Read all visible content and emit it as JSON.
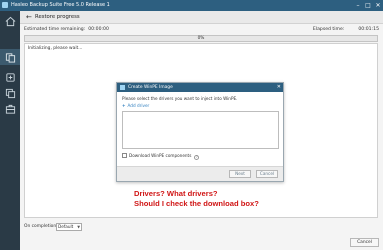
{
  "window": {
    "title": "Hasleo Backup Suite Free 5.0 Release 1",
    "brand_color": "#2d5f80"
  },
  "sidebar": {
    "items": [
      {
        "icon": "home-icon",
        "active": false
      },
      {
        "icon": "backup-icon",
        "active": true
      },
      {
        "icon": "restore-icon",
        "active": false
      },
      {
        "icon": "clone-icon",
        "active": false
      },
      {
        "icon": "tools-icon",
        "active": false
      }
    ]
  },
  "header": {
    "title": "Restore progress"
  },
  "status": {
    "estimated_label": "Estimated time remaining:",
    "estimated_value": "00:00:00",
    "elapsed_label": "Elapsed time:",
    "elapsed_value": "00:01:15"
  },
  "progress": {
    "percent_text": "0%",
    "value": 0
  },
  "log": {
    "lines": [
      "Initializing, please wait..."
    ]
  },
  "modal": {
    "title": "Create WinPE Image",
    "description": "Please select the drivers you want to inject into WinPE.",
    "add_driver": "Add driver",
    "download_label": "Download WinPE components",
    "next_label": "Next",
    "cancel_label": "Cancel"
  },
  "annotation": {
    "line1": "Drivers? What drivers?",
    "line2": "Should I check the download box?",
    "color": "#d01515"
  },
  "bottom": {
    "on_completion_label": "On completion",
    "on_completion_value": "Default",
    "cancel_label": "Cancel"
  }
}
